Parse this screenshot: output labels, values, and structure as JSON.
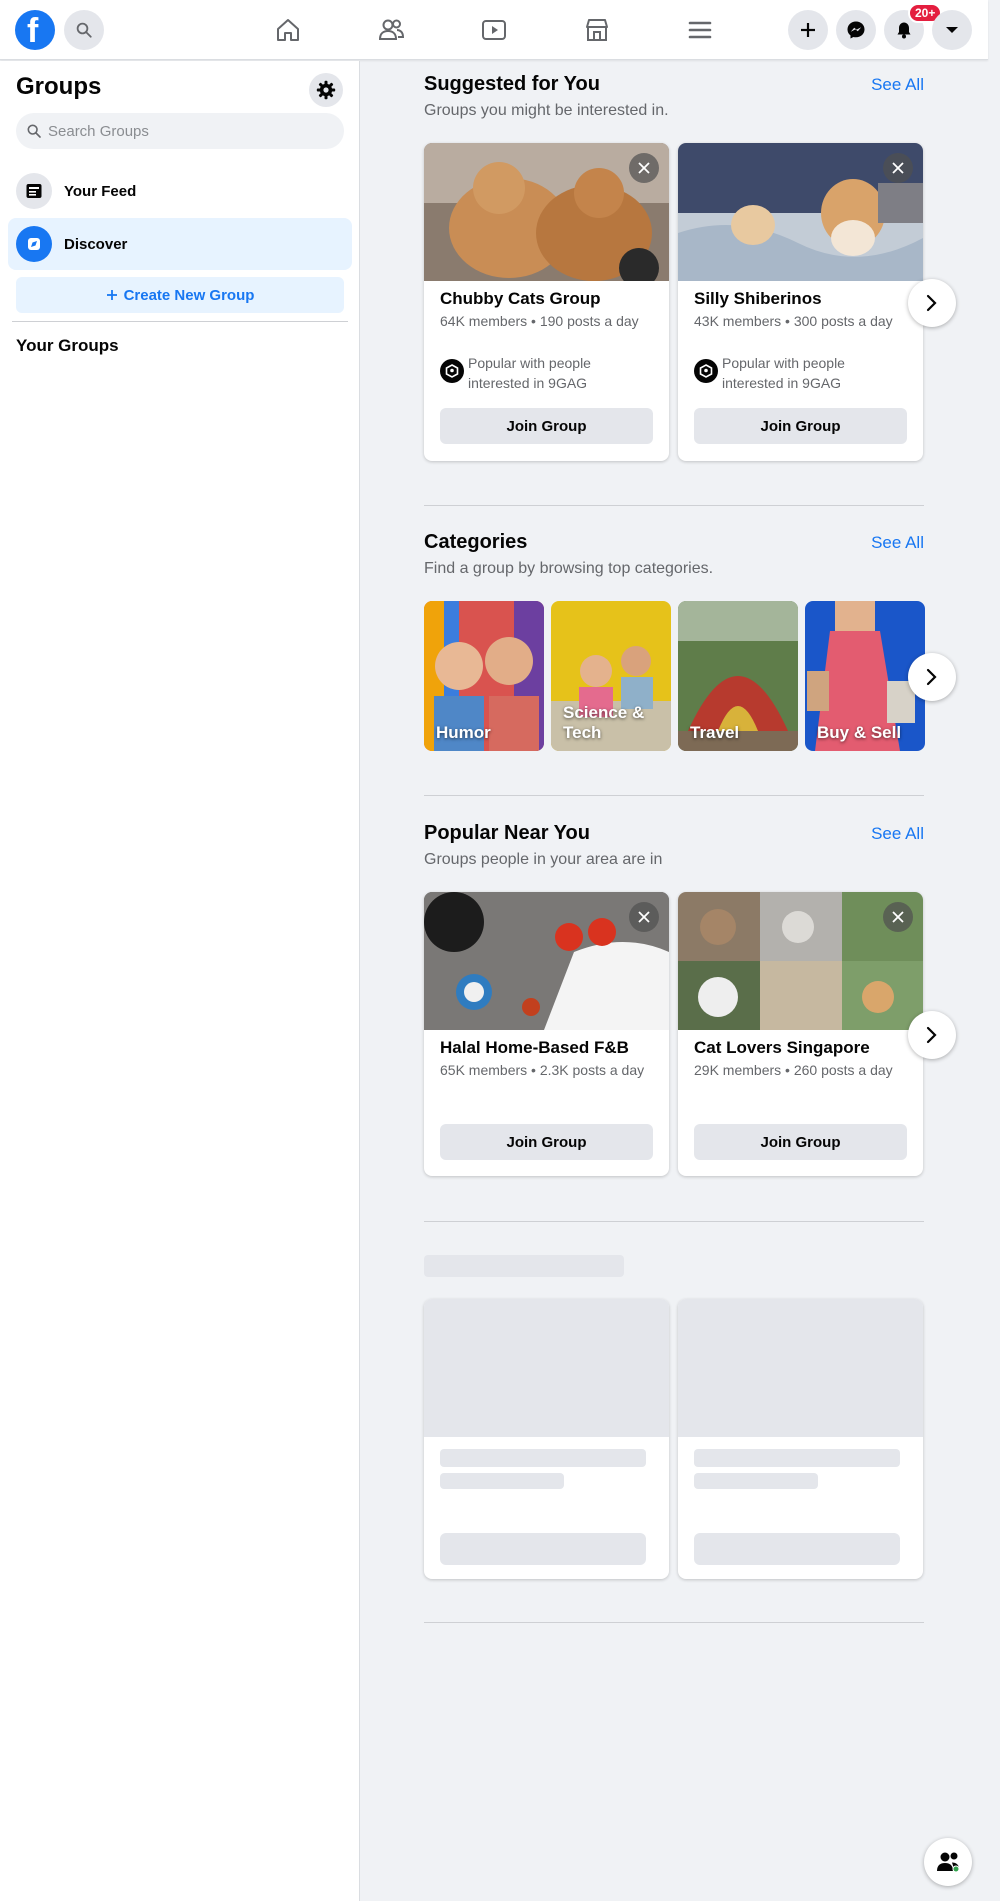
{
  "topbar": {
    "logo_letter": "f",
    "notifications_badge": "20+",
    "icons": [
      "facebook-logo",
      "search-icon",
      "home-icon",
      "friends-icon",
      "watch-icon",
      "marketplace-icon",
      "menu-icon",
      "plus-icon",
      "messenger-icon",
      "bell-icon",
      "caret-down-icon"
    ]
  },
  "sidebar": {
    "title": "Groups",
    "search_placeholder": "Search Groups",
    "items": [
      {
        "label": "Your Feed",
        "icon": "feed-icon"
      },
      {
        "label": "Discover",
        "icon": "discover-icon"
      }
    ],
    "create_label": "Create New Group",
    "your_groups_label": "Your Groups"
  },
  "suggested": {
    "title": "Suggested for You",
    "subtitle": "Groups you might be interested in.",
    "see_all": "See All",
    "cards": [
      {
        "name": "Chubby Cats Group",
        "stats": "64K members • 190 posts a day",
        "reason": "Popular with people interested in 9GAG",
        "join": "Join Group"
      },
      {
        "name": "Silly Shiberinos",
        "stats": "43K members • 300 posts a day",
        "reason": "Popular with people interested in 9GAG",
        "join": "Join Group"
      }
    ]
  },
  "categories": {
    "title": "Categories",
    "subtitle": "Find a group by browsing top categories.",
    "see_all": "See All",
    "items": [
      {
        "label": "Humor"
      },
      {
        "label": "Science & Tech"
      },
      {
        "label": "Travel"
      },
      {
        "label": "Buy & Sell"
      }
    ]
  },
  "popular": {
    "title": "Popular Near You",
    "subtitle": "Groups people in your area are in",
    "see_all": "See All",
    "cards": [
      {
        "name": "Halal Home-Based F&B",
        "stats": "65K members • 2.3K posts a day",
        "join": "Join Group"
      },
      {
        "name": "Cat Lovers Singapore",
        "stats": "29K members • 260 posts a day",
        "join": "Join Group"
      }
    ]
  },
  "colors": {
    "brand": "#1877f2",
    "badge": "#e41e3f",
    "background": "#f0f2f5",
    "secondary_text": "#65676b"
  }
}
